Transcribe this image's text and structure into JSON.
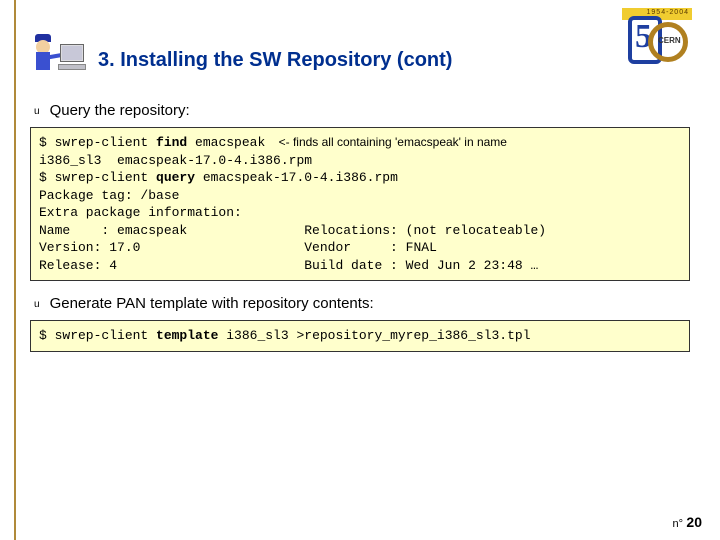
{
  "header": {
    "title": "3. Installing the SW Repository (cont)",
    "logo_years": "1954-2004",
    "logo_org": "CERN"
  },
  "bullets": {
    "b1": "Query the repository:",
    "b2": "Generate PAN template with repository contents:"
  },
  "code1": {
    "l1a": "$ swrep-client ",
    "l1b": "find",
    "l1c": " emacspeak",
    "l1comment": "    <- finds all containing 'emacspeak' in name",
    "l2": "i386_sl3  emacspeak-17.0-4.i386.rpm",
    "l3a": "$ swrep-client ",
    "l3b": "query",
    "l3c": " emacspeak-17.0-4.i386.rpm",
    "l4": "Package tag: /base",
    "l5": "Extra package information:",
    "l6": "Name    : emacspeak               Relocations: (not relocateable)",
    "l7": "Version: 17.0                     Vendor     : FNAL",
    "l8": "Release: 4                        Build date : Wed Jun 2 23:48 …"
  },
  "code2": {
    "l1a": "$ swrep-client ",
    "l1b": "template",
    "l1c": " i386_sl3 >repository_myrep_i386_sl3.tpl"
  },
  "footer": {
    "label": "n°",
    "page": "20"
  }
}
